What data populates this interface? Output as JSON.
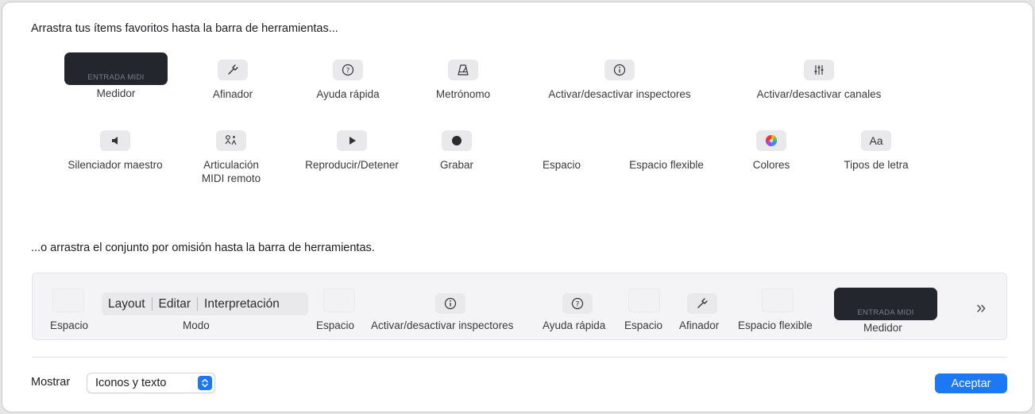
{
  "heading_favorites": "Arrastra tus ítems favoritos hasta la barra de herramientas...",
  "heading_default": "...o arrastra el conjunto por omisión hasta la barra de herramientas.",
  "palette": {
    "meter_text": "ENTRADA MIDI",
    "meter": "Medidor",
    "tuner": "Afinador",
    "quick_help": "Ayuda rápida",
    "metronome": "Metrónomo",
    "inspectors": "Activar/desactivar inspectores",
    "channels": "Activar/desactivar canales",
    "master_mute": "Silenciador maestro",
    "articulation_l1": "Articulación",
    "articulation_l2": "MIDI remoto",
    "play_stop": "Reproducir/Detener",
    "record": "Grabar",
    "space": "Espacio",
    "flex_space": "Espacio flexible",
    "colors": "Colores",
    "fonts_glyph": "Aa",
    "fonts": "Tipos de letra"
  },
  "default_set": {
    "space1": "Espacio",
    "mode_segments": [
      "Layout",
      "Editar",
      "Interpretación"
    ],
    "mode": "Modo",
    "space2": "Espacio",
    "inspectors": "Activar/desactivar inspectores",
    "quick_help": "Ayuda rápida",
    "space3": "Espacio",
    "tuner": "Afinador",
    "flex_space": "Espacio flexible",
    "meter_text": "ENTRADA MIDI",
    "meter": "Medidor",
    "overflow": "»"
  },
  "footer": {
    "show_label": "Mostrar",
    "show_value": "Iconos y texto",
    "accept": "Aceptar"
  },
  "colors": {
    "accent": "#1c78f5",
    "meter_bg": "#23262d"
  }
}
